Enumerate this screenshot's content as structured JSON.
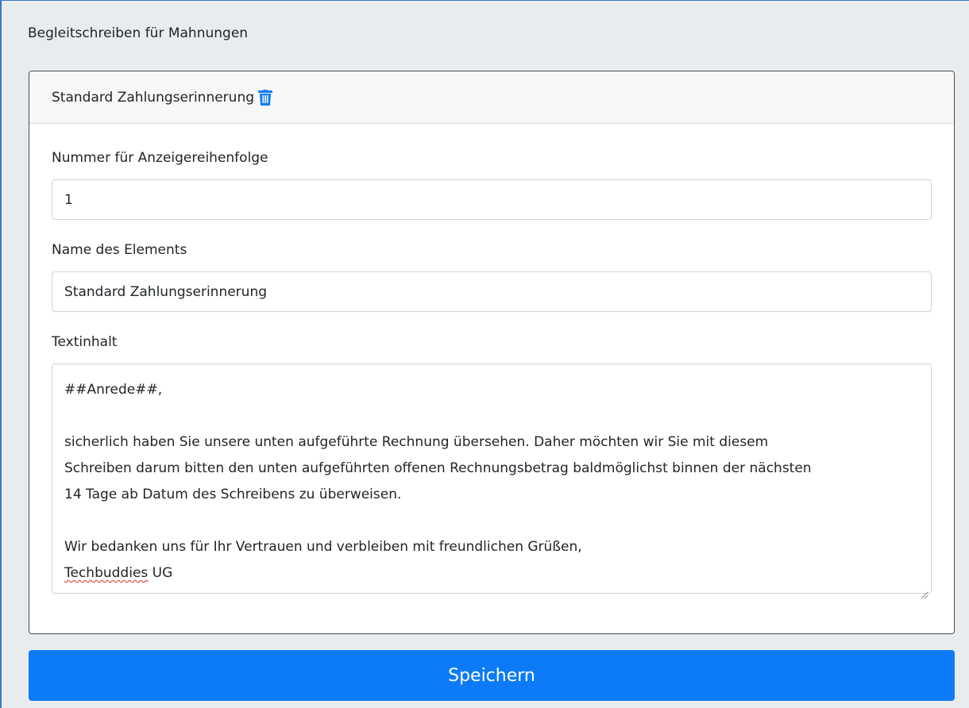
{
  "page": {
    "title": "Begleitschreiben für Mahnungen"
  },
  "card": {
    "title": "Standard Zahlungserinnerung",
    "delete_icon": "trash-icon",
    "accent_color": "#0d7bf7"
  },
  "form": {
    "order_label": "Nummer für Anzeigereihenfolge",
    "order_value": "1",
    "name_label": "Name des Elements",
    "name_value": "Standard Zahlungserinnerung",
    "text_label": "Textinhalt",
    "text_lines": [
      "##Anrede##,",
      "",
      "sicherlich haben Sie unsere unten aufgeführte Rechnung übersehen. Daher möchten wir Sie mit diesem",
      "Schreiben darum bitten den unten aufgeführten offenen Rechnungsbetrag baldmöglichst binnen der nächsten",
      "14 Tage ab Datum des Schreibens zu überweisen.",
      "",
      "Wir bedanken uns für Ihr Vertrauen und verbleiben mit freundlichen Grüßen,"
    ],
    "signature_misspelled": "Techbuddies",
    "signature_rest": " UG"
  },
  "actions": {
    "save_label": "Speichern"
  }
}
